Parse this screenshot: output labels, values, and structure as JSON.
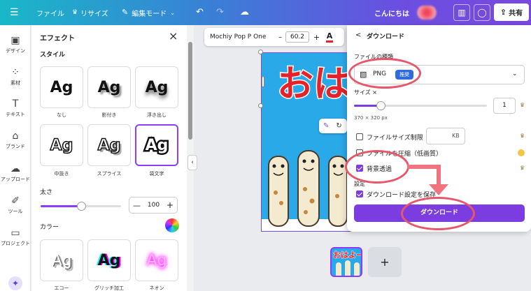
{
  "topbar": {
    "menu_icon": "menu-icon",
    "file": "ファイル",
    "resize": "リサイズ",
    "edit_mode": "編集モード",
    "greeting": "こんにちは",
    "share": "共有"
  },
  "rail": {
    "items": [
      {
        "icon": "design-icon",
        "label": "デザイン"
      },
      {
        "icon": "elements-icon",
        "label": "素材"
      },
      {
        "icon": "text-icon",
        "label": "テキスト"
      },
      {
        "icon": "brand-icon",
        "label": "ブランド"
      },
      {
        "icon": "upload-icon",
        "label": "アップロード"
      },
      {
        "icon": "tools-icon",
        "label": "ツール"
      },
      {
        "icon": "project-icon",
        "label": "プロジェクト"
      }
    ]
  },
  "effects": {
    "title": "エフェクト",
    "style_heading": "スタイル",
    "styles": [
      {
        "sample": "Ag",
        "label": "なし"
      },
      {
        "sample": "Ag",
        "label": "影付き"
      },
      {
        "sample": "Ag",
        "label": "浮き出し"
      },
      {
        "sample": "Ag",
        "label": "中抜き"
      },
      {
        "sample": "Ag",
        "label": "スプライス"
      },
      {
        "sample": "Ag",
        "label": "袋文字"
      }
    ],
    "selected_style": "袋文字",
    "thickness_label": "太さ",
    "thickness_value": "100",
    "thickness_fraction": 0.5,
    "color_label": "カラー",
    "more_styles": [
      {
        "sample": "Ag",
        "label": "エコー"
      },
      {
        "sample": "Ag",
        "label": "グリッチ加工"
      },
      {
        "sample": "Ag",
        "label": "ネオン"
      }
    ]
  },
  "text_toolbar": {
    "font": "Mochiy Pop P One",
    "minus": "–",
    "size": "60.2",
    "plus": "+",
    "color_letter": "A"
  },
  "canvas": {
    "headline": "おはよ",
    "thumb_text": "おはよー",
    "add_page": "+"
  },
  "download": {
    "back": "<",
    "title": "ダウンロード",
    "file_type_label": "ファイルの種類",
    "file_type": "PNG",
    "file_type_badge": "推奨",
    "size_label": "サイズ ×",
    "size_value": "1",
    "size_fraction": 0.2,
    "dimensions": "370 × 320 px",
    "limit_size": "ファイルサイズ制限",
    "kb": "KB",
    "compress": "ファイルを圧縮（低画質）",
    "transparent": "背景透過",
    "settings_label": "設定",
    "save_settings": "ダウンロード設定を保存",
    "button": "ダウンロード"
  },
  "colors": {
    "accent": "#7b3ddf",
    "annotation": "#e8566b",
    "canvas_bg": "#29a9e8",
    "headline": "#e3232c"
  }
}
